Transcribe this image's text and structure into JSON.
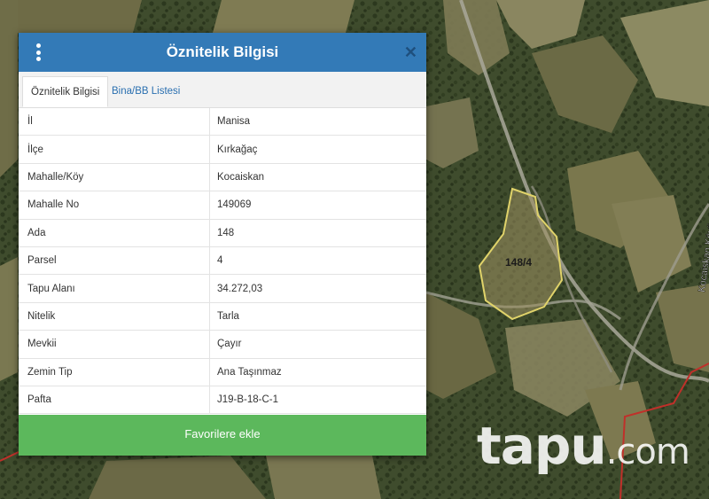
{
  "panel": {
    "title": "Öznitelik Bilgisi",
    "menu_icon": "vertical-dots-icon",
    "close_symbol": "✕",
    "tabs": [
      {
        "label": "Öznitelik Bilgisi",
        "active": true
      },
      {
        "label": "Bina/BB Listesi",
        "active": false
      }
    ],
    "rows": [
      {
        "label": "İl",
        "value": "Manisa"
      },
      {
        "label": "İlçe",
        "value": "Kırkağaç"
      },
      {
        "label": "Mahalle/Köy",
        "value": "Kocaiskan"
      },
      {
        "label": "Mahalle No",
        "value": "149069"
      },
      {
        "label": "Ada",
        "value": "148"
      },
      {
        "label": "Parsel",
        "value": "4"
      },
      {
        "label": "Tapu Alanı",
        "value": "34.272,03"
      },
      {
        "label": "Nitelik",
        "value": "Tarla"
      },
      {
        "label": "Mevkii",
        "value": "Çayır"
      },
      {
        "label": "Zemin Tip",
        "value": "Ana Taşınmaz"
      },
      {
        "label": "Pafta",
        "value": "J19-B-18-C-1"
      }
    ],
    "favorite_button": "Favorilere ekle"
  },
  "map": {
    "parcel_label": "148/4",
    "road_label": "Kocaiskan Köyü",
    "parcel_outline_color": "#e0d36a",
    "boundary_color": "#c0302a"
  },
  "watermark": {
    "brand": "tapu",
    "domain": ".com"
  },
  "colors": {
    "header": "#337ab7",
    "button": "#5cb85c",
    "tab_link": "#2a6fb0"
  }
}
